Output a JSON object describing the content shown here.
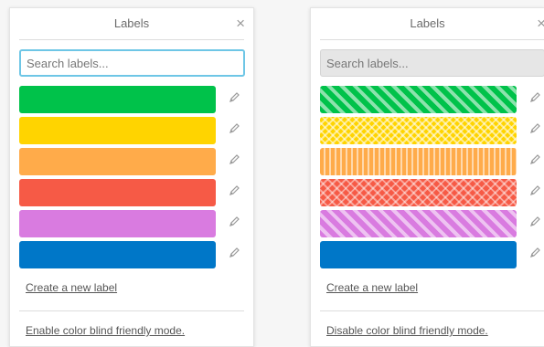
{
  "left_panel": {
    "title": "Labels",
    "close": "×",
    "search": {
      "placeholder": "Search labels...",
      "value": ""
    },
    "create_label": "Create a new label",
    "blind_mode_link": "Enable color blind friendly mode.",
    "labels": [
      {
        "color": "#00c24a",
        "pattern": "solid"
      },
      {
        "color": "#ffd400",
        "pattern": "solid"
      },
      {
        "color": "#ffab4a",
        "pattern": "solid"
      },
      {
        "color": "#f65a46",
        "pattern": "solid"
      },
      {
        "color": "#d97be0",
        "pattern": "solid"
      },
      {
        "color": "#0077c8",
        "pattern": "solid"
      }
    ]
  },
  "right_panel": {
    "title": "Labels",
    "close": "×",
    "search": {
      "placeholder": "Search labels...",
      "value": ""
    },
    "create_label": "Create a new label",
    "blind_mode_link": "Disable color blind friendly mode.",
    "labels": [
      {
        "color": "#00c24a",
        "pattern": "diagonal-stripes"
      },
      {
        "color": "#ffd400",
        "pattern": "diamonds"
      },
      {
        "color": "#ffab4a",
        "pattern": "vertical-stripes"
      },
      {
        "color": "#f65a46",
        "pattern": "checker"
      },
      {
        "color": "#d97be0",
        "pattern": "diagonal-stripes"
      },
      {
        "color": "#0077c8",
        "pattern": "solid"
      }
    ]
  }
}
